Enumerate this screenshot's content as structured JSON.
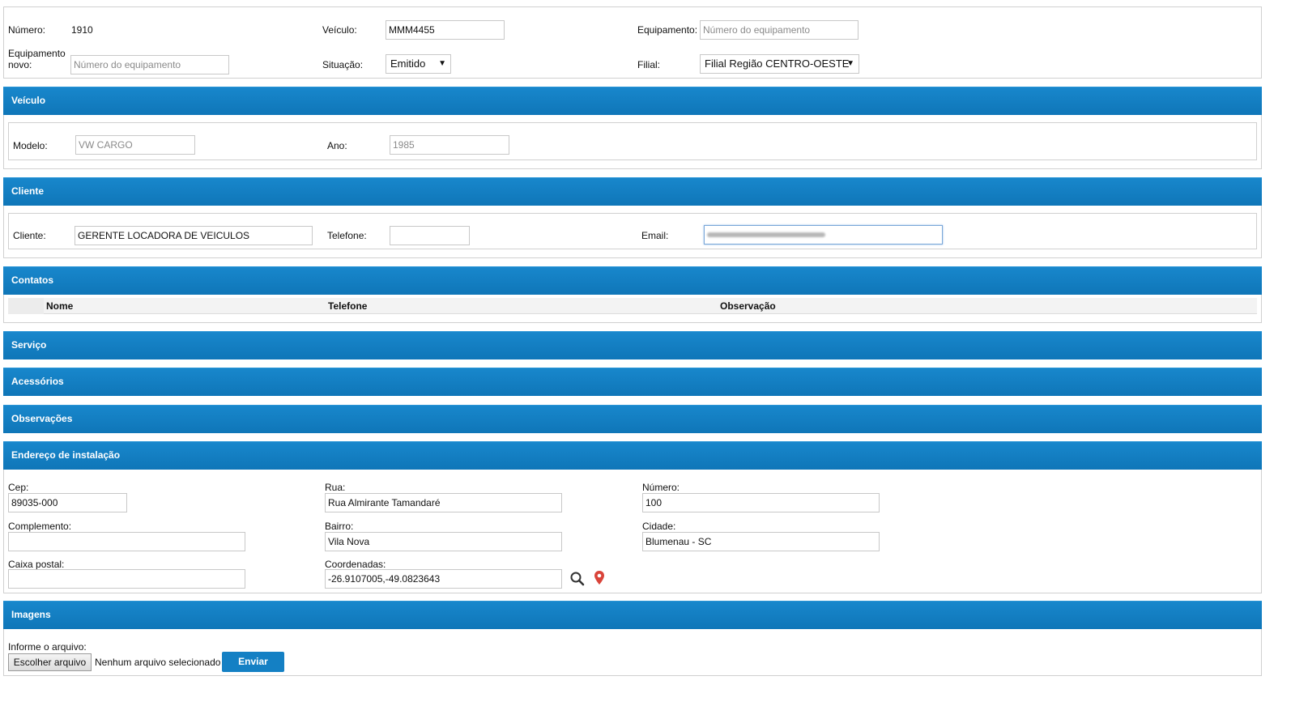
{
  "header": {
    "numero_label": "Número:",
    "numero_value": "1910",
    "veiculo_label": "Veículo:",
    "veiculo_value": "MMM4455",
    "equipamento_label": "Equipamento:",
    "equipamento_placeholder": "Número do equipamento",
    "equipamento_novo_label_1": "Equipamento",
    "equipamento_novo_label_2": "novo:",
    "equipamento_novo_placeholder": "Número do equipamento",
    "situacao_label": "Situação:",
    "situacao_value": "Emitido",
    "filial_label": "Filial:",
    "filial_value": "Filial Região CENTRO-OESTE"
  },
  "veiculo": {
    "title": "Veículo",
    "modelo_label": "Modelo:",
    "modelo_value": "VW CARGO",
    "ano_label": "Ano:",
    "ano_value": "1985"
  },
  "cliente": {
    "title": "Cliente",
    "cliente_label": "Cliente:",
    "cliente_value": "GERENTE LOCADORA DE VEICULOS",
    "telefone_label": "Telefone:",
    "telefone_value": "",
    "email_label": "Email:"
  },
  "contatos": {
    "title": "Contatos",
    "columns": [
      "Nome",
      "Telefone",
      "Observação"
    ]
  },
  "sections": {
    "servico": "Serviço",
    "acessorios": "Acessórios",
    "observacoes": "Observações"
  },
  "endereco": {
    "title": "Endereço de instalação",
    "cep_label": "Cep:",
    "cep_value": "89035-000",
    "rua_label": "Rua:",
    "rua_value": "Rua Almirante Tamandaré",
    "numero_label": "Número:",
    "numero_value": "100",
    "complemento_label": "Complemento:",
    "complemento_value": "",
    "bairro_label": "Bairro:",
    "bairro_value": "Vila Nova",
    "cidade_label": "Cidade:",
    "cidade_value": "Blumenau - SC",
    "caixa_postal_label": "Caixa postal:",
    "caixa_postal_value": "",
    "coordenadas_label": "Coordenadas:",
    "coordenadas_value": "-26.9107005,-49.0823643",
    "search_icon": "search-icon",
    "map_pin_icon": "map-pin-icon"
  },
  "imagens": {
    "title": "Imagens",
    "informe_label": "Informe o arquivo:",
    "choose_file_label": "Escolher arquivo",
    "no_file_label": "Nenhum arquivo selecionado",
    "send_label": "Enviar"
  },
  "colors": {
    "section_bar": "#1480c4",
    "pin": "#d9443a"
  }
}
